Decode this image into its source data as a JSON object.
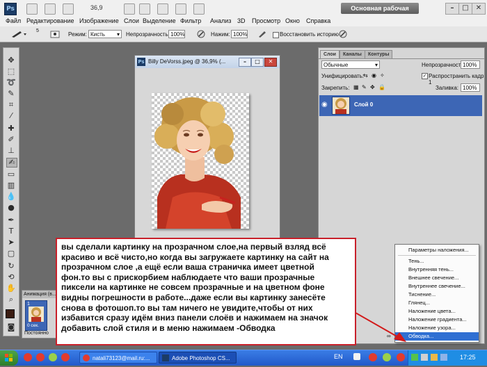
{
  "titlebar": {
    "logo": "Ps",
    "zoom": "36,9",
    "workspace": "Основная рабочая среда",
    "ctl_min": "–",
    "ctl_max": "□",
    "ctl_close": "✕"
  },
  "menu": [
    "Файл",
    "Редактирование",
    "Изображение",
    "Слои",
    "Выделение",
    "Фильтр",
    "Анализ",
    "3D",
    "Просмотр",
    "Окно",
    "Справка"
  ],
  "options": {
    "mode_label": "Режим:",
    "mode_value": "Кисть",
    "opacity_label": "Непрозрачность:",
    "opacity_value": "100%",
    "pressure_label": "Нажим:",
    "pressure_value": "100%",
    "restore_label": "Восстановить историю",
    "brush_size": "5"
  },
  "document": {
    "title": "Billy DeVorss.jpeg @ 36,9% (..."
  },
  "animation": {
    "title": "Анимация (в...",
    "frame_number": "1",
    "frame_delay": "0 сек.",
    "loop": "Постоянно"
  },
  "layers": {
    "tabs": [
      "Слои",
      "Каналы",
      "Контуры"
    ],
    "blend_mode": "Обычные",
    "opacity_label": "Непрозрачность:",
    "opacity_value": "100%",
    "unify_label": "Унифицировать:",
    "propagate_label": "Распространить кадр 1",
    "lock_label": "Закрепить:",
    "fill_label": "Заливка:",
    "fill_value": "100%",
    "layer_name": "Слой 0"
  },
  "context_menu": {
    "items": [
      "Параметры наложения...",
      "Тень...",
      "Внутренняя тень...",
      "Внешнее свечение...",
      "Внутреннее свечение...",
      "Тиснение...",
      "Глянец...",
      "Наложение цвета...",
      "Наложение градиента...",
      "Наложение узора...",
      "Обводка..."
    ],
    "highlighted": "Обводка..."
  },
  "annotation": {
    "text": "вы сделали картинку на прозрачном слое,на первый взляд всё\nкрасиво и всё чисто,но когда вы загружаете картинку на сайт на\nпрозрачном слое ,а ещё если ваша страничка имеет цветной\nфон.то вы с прискорбием наблюдаете что ваши прозрачные\nпиксели на картинке не совсем прозрачные и на цветном фоне\nвидны погрешности в работе...даже если вы картинку занесёте\nснова в фотошоп.то вы там ничего не увидите,чтобы от них\nизбавится сразу идём вниз панели слоёв и нажимаем на значок\nдобавить слой стиля и в меню нажимаем -Обводка"
  },
  "taskbar": {
    "tasks": [
      "natali73123@mail.ru:...",
      "Adobe Photoshop CS..."
    ],
    "lang": "EN",
    "clock": "17:25"
  },
  "colors": {
    "accent_blue": "#3d66b5",
    "menu_highlight": "#2f6fd2",
    "annotation_border": "#c8202a",
    "arrow_red": "#d21a1a"
  }
}
